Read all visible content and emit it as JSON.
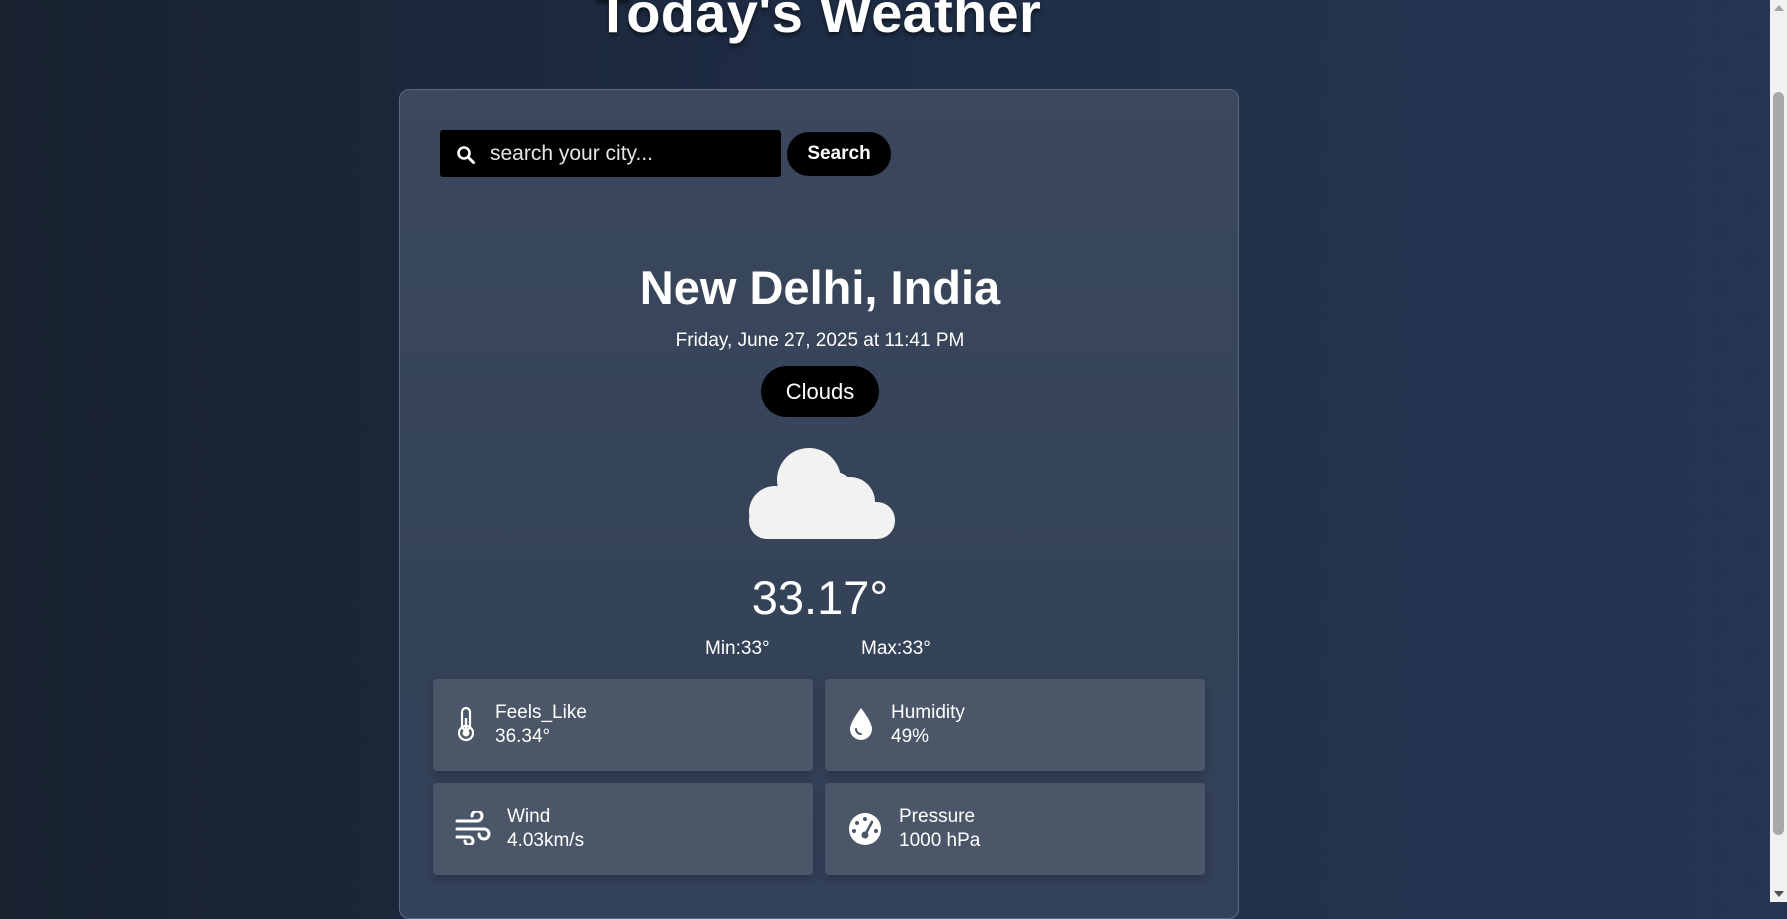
{
  "header": {
    "title": "Today's Weather"
  },
  "search": {
    "placeholder": "search your city...",
    "value": "",
    "button_label": "Search"
  },
  "location": {
    "city": "New Delhi, India",
    "datetime": "Friday, June 27, 2025 at 11:41 PM"
  },
  "condition": {
    "label": "Clouds",
    "icon": "cloud-icon"
  },
  "temperature": {
    "current": "33.17°",
    "min": "Min:33°",
    "max": "Max:33°"
  },
  "stats": [
    {
      "label": "Feels_Like",
      "value": "36.34°",
      "icon": "thermometer-icon"
    },
    {
      "label": "Humidity",
      "value": "49%",
      "icon": "droplet-icon"
    },
    {
      "label": "Wind",
      "value": "4.03km/s",
      "icon": "wind-icon"
    },
    {
      "label": "Pressure",
      "value": "1000 hPa",
      "icon": "gauge-icon"
    }
  ],
  "colors": {
    "card_background": "#364359",
    "stat_card_background": "#4b5668",
    "badge_background": "#000000",
    "text": "#ffffff"
  }
}
